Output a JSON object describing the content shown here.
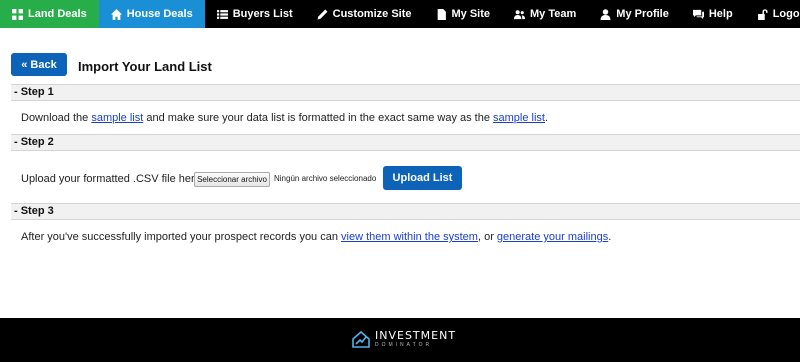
{
  "nav": {
    "items": [
      {
        "label": "Land Deals",
        "icon": "grid-icon"
      },
      {
        "label": "House Deals",
        "icon": "home-icon"
      },
      {
        "label": "Buyers List",
        "icon": "list-icon"
      },
      {
        "label": "Customize Site",
        "icon": "pencil-icon"
      },
      {
        "label": "My Site",
        "icon": "document-icon"
      },
      {
        "label": "My Team",
        "icon": "team-icon"
      },
      {
        "label": "My Profile",
        "icon": "user-icon"
      }
    ],
    "right": [
      {
        "label": "Help",
        "icon": "chat-icon"
      },
      {
        "label": "Logout",
        "icon": "unlock-icon"
      }
    ],
    "active_colors": {
      "land_deals": "#27ae4a",
      "house_deals": "#1b8fd6"
    }
  },
  "page": {
    "back_label": "« Back",
    "title": "Import Your Land List"
  },
  "step1": {
    "header": "- Step 1",
    "text_a": "Download the ",
    "link1": "sample list",
    "text_b": " and make sure your data list is formatted in the exact same way as the ",
    "link2": "sample list",
    "text_c": "."
  },
  "step2": {
    "header": "- Step 2",
    "label": "Upload your formatted .CSV file here:",
    "file_button": "Seleccionar archivo",
    "file_status": "Ningún archivo seleccionado",
    "upload_label": "Upload List"
  },
  "step3": {
    "header": "- Step 3",
    "text_a": "After you've successfully imported your prospect records you can ",
    "link1": "view them within the system",
    "text_b": ", or ",
    "link2": "generate your mailings",
    "text_c": "."
  },
  "footer": {
    "logo_main": "INVESTMENT",
    "logo_sub": "DOMINATOR"
  },
  "colors": {
    "primary_button": "#0d63b8",
    "link": "#1a3ecf"
  }
}
